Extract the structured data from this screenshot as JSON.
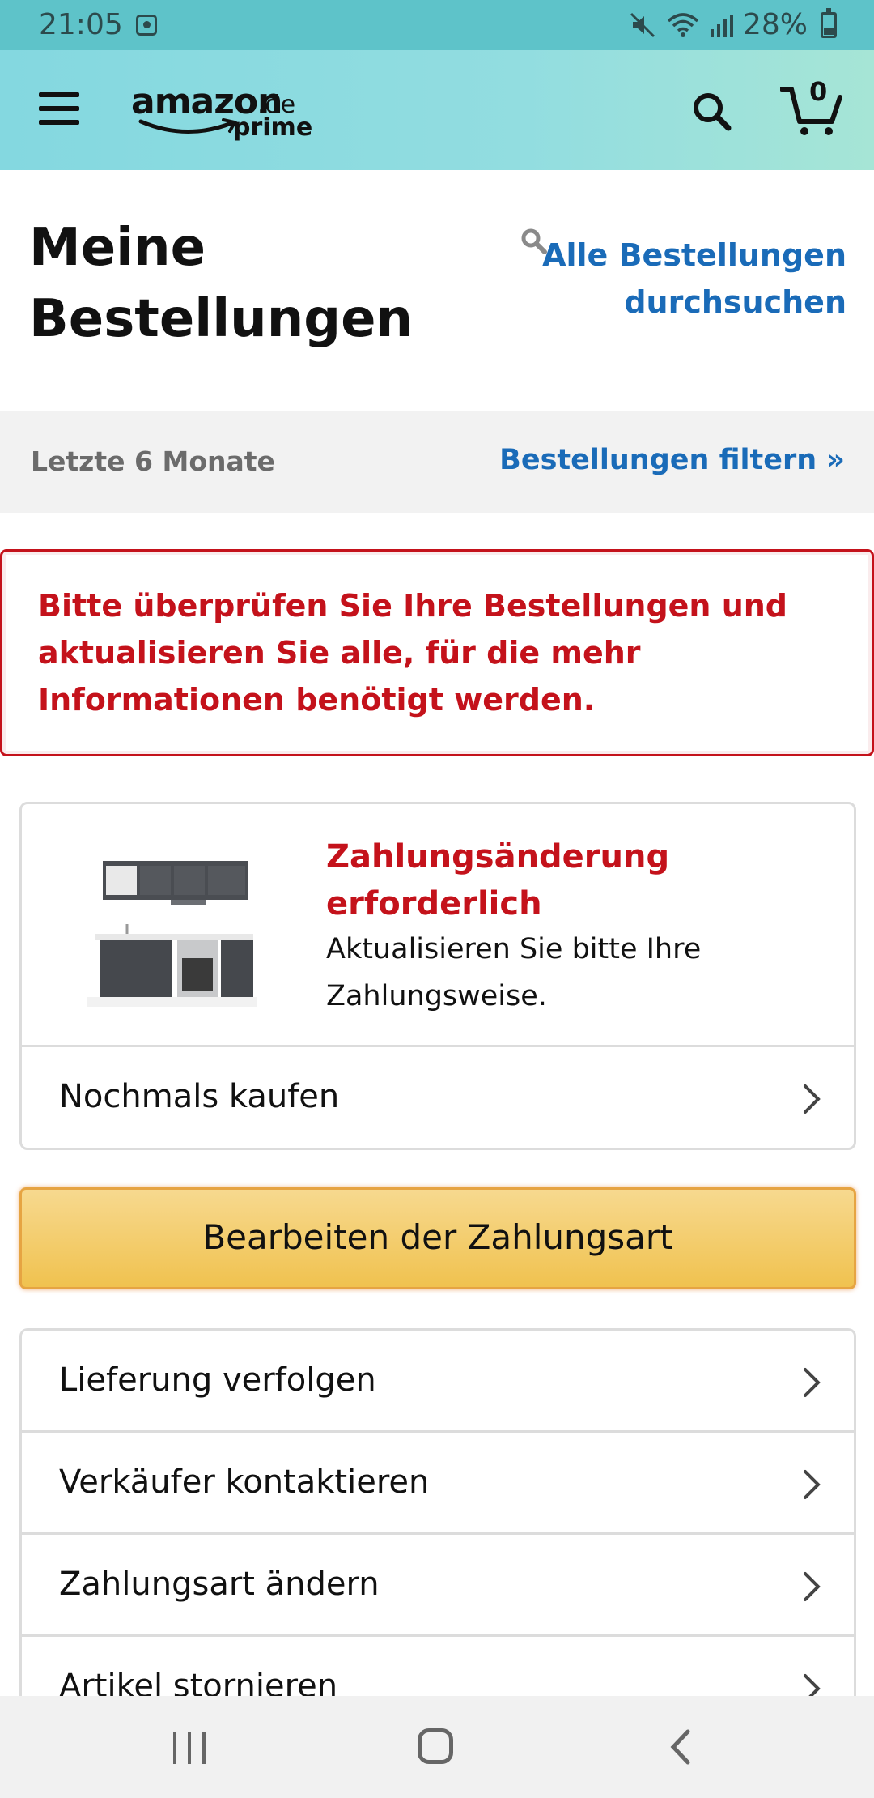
{
  "status_bar": {
    "time": "21:05",
    "battery": "28%",
    "icons": [
      "alarm-icon",
      "mute-icon",
      "wifi-icon",
      "signal-icon",
      "battery-icon"
    ]
  },
  "header": {
    "logo_amazon": "amazon",
    "logo_tld": ".de",
    "logo_prime": "prime",
    "cart_count": "0",
    "icons": [
      "menu-icon",
      "search-icon",
      "cart-icon"
    ]
  },
  "page": {
    "title": "Meine Bestellungen",
    "search_link": "Alle Bestellungen durchsuchen"
  },
  "filter": {
    "period": "Letzte 6 Monate",
    "link": "Bestellungen filtern »"
  },
  "alert": {
    "message": "Bitte überprüfen Sie Ihre Bestellungen und aktualisieren Sie alle, für die mehr Informationen benötigt werden."
  },
  "order": {
    "status_title": "Zahlungsänderung erforderlich",
    "status_desc": "Aktualisieren Sie bitte Ihre Zahlungsweise.",
    "buy_again": "Nochmals kaufen"
  },
  "primary_action": "Bearbeiten der Zahlungsart",
  "actions": [
    {
      "label": "Lieferung verfolgen"
    },
    {
      "label": "Verkäufer kontaktieren"
    },
    {
      "label": "Zahlungsart ändern"
    },
    {
      "label": "Artikel stornieren"
    }
  ],
  "colors": {
    "status_bar": "#5ec3c9",
    "header": "#92dde0",
    "link": "#1a6bb8",
    "alert": "#c4121b",
    "button": "#f0c24f"
  }
}
